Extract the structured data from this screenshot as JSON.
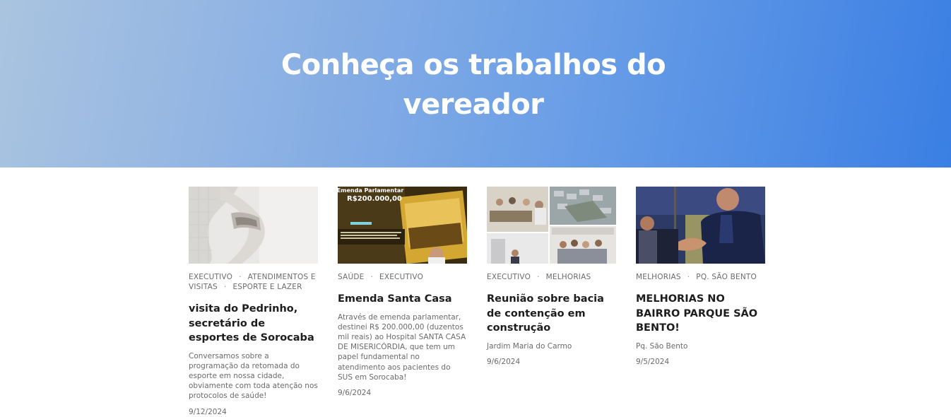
{
  "hero": {
    "title_line1": "Conheça os trabalhos do",
    "title_line2": "vereador"
  },
  "image_text": {
    "emenda_heading": "Emenda Parlamentar",
    "emenda_amount": "R$200.000,00"
  },
  "cards": [
    {
      "categories": [
        "EXECUTIVO",
        "ATENDIMENTOS E VISITAS",
        "ESPORTE E LAZER"
      ],
      "title": "visita do Pedrinho, secretário de esportes de Sorocaba",
      "excerpt": "Conversamos sobre a programação da retomada do esporte em nossa cidade, obviamente com toda atenção nos protocolos de saúde!",
      "date": "9/12/2024"
    },
    {
      "categories": [
        "SAÚDE",
        "EXECUTIVO"
      ],
      "title": "Emenda Santa Casa",
      "excerpt": "Através de emenda parlamentar, destinei R$ 200.000,00 (duzentos mil reais) ao Hospital SANTA CASA DE MISERICÓRDIA, que tem um papel fundamental no atendimento aos pacientes do SUS em Sorocaba!",
      "date": "9/6/2024"
    },
    {
      "categories": [
        "EXECUTIVO",
        "MELHORIAS"
      ],
      "title": "Reunião sobre bacia de contenção em construção",
      "place": "Jardim Maria do Carmo",
      "date": "9/6/2024"
    },
    {
      "categories": [
        "MELHORIAS",
        "PQ. SÃO BENTO"
      ],
      "title": "MELHORIAS NO BAIRRO PARQUE SÃO BENTO!",
      "place": "Pq. São Bento",
      "date": "9/5/2024"
    }
  ]
}
